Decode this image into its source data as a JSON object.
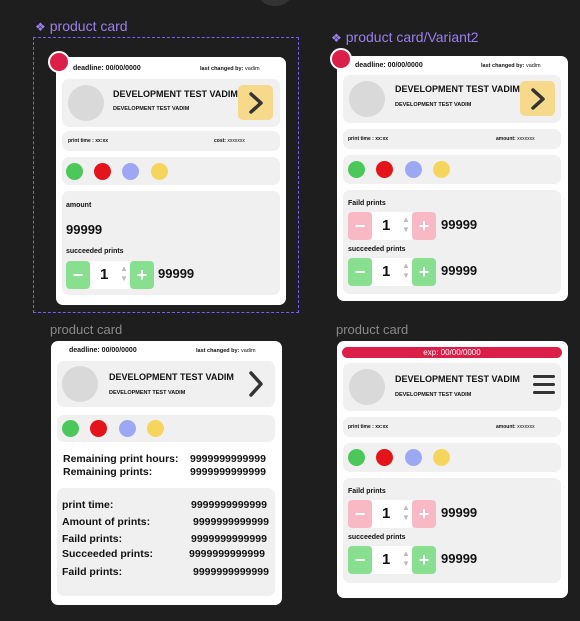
{
  "labels": {
    "card1": "product card",
    "card2": "product card/Variant2",
    "card3": "product card",
    "card4": "product card"
  },
  "common": {
    "deadline": "deadline: 00/00/0000",
    "last_changed_prefix": "last changed by:",
    "last_changed_user": "vadim",
    "title": "DEVELOPMENT TEST VADIM",
    "subtitle": "DEVELOPMENT TEST VADIM",
    "print_time": "print time : xx:xx",
    "cost_label": "cost:",
    "cost_value": "xxxxxxx",
    "amount_label_short": "amount:",
    "amount_value_short": "xxxxxxx",
    "colors": [
      "#4cc85a",
      "#e4141b",
      "#9da8f4",
      "#f6d55d"
    ]
  },
  "card1": {
    "amount_label": "amount",
    "amount_value": "99999",
    "succeeded_label": "succeeded prints",
    "stepper_value": "1",
    "stepper_total": "99999"
  },
  "card2": {
    "faild_label": "Faild prints",
    "faild_value": "1",
    "faild_total": "99999",
    "succeeded_label": "succeeded prints",
    "succeeded_value": "1",
    "succeeded_total": "99999"
  },
  "card3": {
    "remaining_hours_label": "Remaining print hours:",
    "remaining_hours_value": "9999999999999",
    "remaining_prints_label": "Remaining prints:",
    "remaining_prints_value": "9999999999999",
    "rows": [
      {
        "label": "print time:",
        "value": "9999999999999"
      },
      {
        "label": "Amount of prints:",
        "value": "9999999999999"
      },
      {
        "label": "Faild prints:",
        "value": "9999999999999"
      },
      {
        "label": "Succeeded prints:",
        "value": "9999999999999"
      },
      {
        "label": "Faild prints:",
        "value": "9999999999999"
      }
    ]
  },
  "card4": {
    "exp": "exp: 00/00/0000",
    "faild_label": "Faild prints",
    "faild_value": "1",
    "faild_total": "99999",
    "succeeded_label": "succeeded prints",
    "succeeded_value": "1",
    "succeeded_total": "99999"
  },
  "icons": {
    "chevron": "chevron-right-icon",
    "menu": "hamburger-menu-icon",
    "component": "component-diamond-icon"
  }
}
